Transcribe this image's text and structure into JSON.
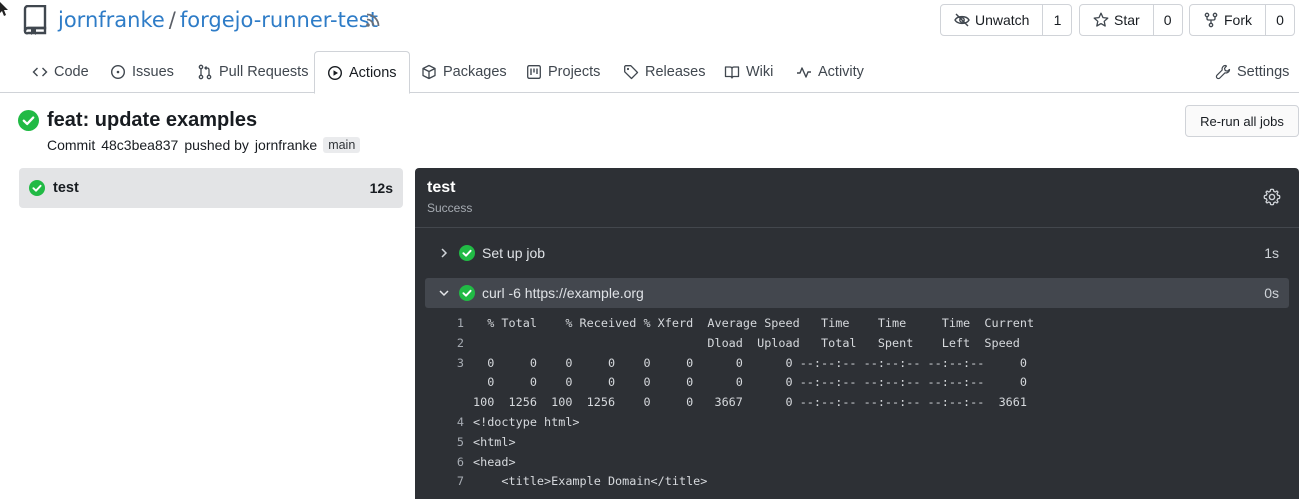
{
  "repo": {
    "owner": "jornfranke",
    "separator": "/",
    "name": "forgejo-runner-test"
  },
  "header_buttons": {
    "unwatch": {
      "label": "Unwatch",
      "count": "1"
    },
    "star": {
      "label": "Star",
      "count": "0"
    },
    "fork": {
      "label": "Fork",
      "count": "0"
    }
  },
  "tabs": [
    {
      "label": "Code",
      "icon": "code-icon"
    },
    {
      "label": "Issues",
      "icon": "issue-icon"
    },
    {
      "label": "Pull Requests",
      "icon": "pull-request-icon"
    },
    {
      "label": "Actions",
      "icon": "play-icon",
      "active": true
    },
    {
      "label": "Packages",
      "icon": "package-icon"
    },
    {
      "label": "Projects",
      "icon": "project-icon"
    },
    {
      "label": "Releases",
      "icon": "tag-icon"
    },
    {
      "label": "Wiki",
      "icon": "book-icon"
    },
    {
      "label": "Activity",
      "icon": "pulse-icon"
    },
    {
      "label": "Settings",
      "icon": "tool-icon"
    }
  ],
  "run": {
    "title": "feat: update examples",
    "commit_prefix": "Commit",
    "commit_sha": "48c3bea837",
    "pushed_by_text": "pushed by",
    "author": "jornfranke",
    "branch": "main",
    "rerun_label": "Re-run all jobs"
  },
  "jobs": [
    {
      "name": "test",
      "duration": "12s"
    }
  ],
  "job_panel": {
    "title": "test",
    "status": "Success",
    "steps": [
      {
        "label": "Set up job",
        "duration": "1s",
        "expanded": false
      },
      {
        "label": "curl -6 https://example.org",
        "duration": "0s",
        "expanded": true
      }
    ],
    "log_lines": [
      {
        "num": "1",
        "text": "  % Total    % Received % Xferd  Average Speed   Time    Time     Time  Current"
      },
      {
        "num": "2",
        "text": "                                 Dload  Upload   Total   Spent    Left  Speed"
      },
      {
        "num": "3",
        "text": "  0     0    0     0    0     0      0      0 --:--:-- --:--:-- --:--:--     0"
      },
      {
        "num": "",
        "text": "  0     0    0     0    0     0      0      0 --:--:-- --:--:-- --:--:--     0"
      },
      {
        "num": "",
        "text": "100  1256  100  1256    0     0   3667      0 --:--:-- --:--:-- --:--:--  3661"
      },
      {
        "num": "4",
        "text": "<!doctype html>"
      },
      {
        "num": "5",
        "text": "<html>"
      },
      {
        "num": "6",
        "text": "<head>"
      },
      {
        "num": "7",
        "text": "    <title>Example Domain</title>"
      }
    ]
  },
  "colors": {
    "link": "#2e7cc7",
    "success": "#21ba45",
    "panel_bg": "#2d3035"
  }
}
